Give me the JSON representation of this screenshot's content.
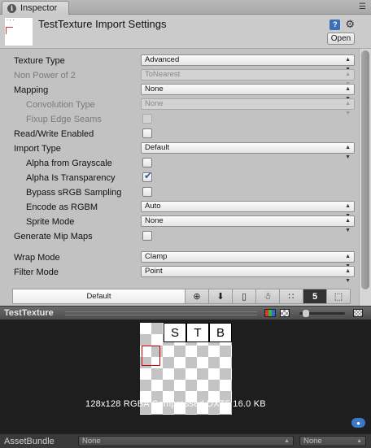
{
  "tab": {
    "label": "Inspector"
  },
  "header": {
    "title": "TestTexture Import Settings",
    "open_label": "Open",
    "thumb_dots": "˙˙˙"
  },
  "settings": {
    "texture_type": {
      "label": "Texture Type",
      "value": "Advanced"
    },
    "non_power_of_2": {
      "label": "Non Power of 2",
      "value": "ToNearest"
    },
    "mapping": {
      "label": "Mapping",
      "value": "None"
    },
    "convolution_type": {
      "label": "Convolution Type",
      "value": "None"
    },
    "fixup_edge_seams": {
      "label": "Fixup Edge Seams",
      "checked": false
    },
    "read_write_enabled": {
      "label": "Read/Write Enabled",
      "checked": false
    },
    "import_type": {
      "label": "Import Type",
      "value": "Default"
    },
    "alpha_from_grayscale": {
      "label": "Alpha from Grayscale",
      "checked": false
    },
    "alpha_is_transparency": {
      "label": "Alpha Is Transparency",
      "checked": true
    },
    "bypass_srgb_sampling": {
      "label": "Bypass sRGB Sampling",
      "checked": false
    },
    "encode_as_rgbm": {
      "label": "Encode as RGBM",
      "value": "Auto"
    },
    "sprite_mode": {
      "label": "Sprite Mode",
      "value": "None"
    },
    "generate_mip_maps": {
      "label": "Generate Mip Maps",
      "checked": false
    },
    "wrap_mode": {
      "label": "Wrap Mode",
      "value": "Clamp"
    },
    "filter_mode": {
      "label": "Filter Mode",
      "value": "Point"
    }
  },
  "platforms": {
    "default_label": "Default",
    "icons": [
      "globe-icon",
      "download-icon",
      "phone-icon",
      "android-icon",
      "blackberry-icon",
      "html5-icon",
      "package-icon"
    ],
    "glyphs": [
      "⊕",
      "⬇",
      "▯",
      "☃",
      "∷",
      "5",
      "⬚"
    ]
  },
  "preview": {
    "title": "TestTexture",
    "letters": [
      "S",
      "T",
      "B"
    ],
    "info": "128x128  RGBA Compressed DXT5    16.0 KB",
    "tag_glyph": "●"
  },
  "asset_bundle": {
    "label": "AssetBundle",
    "name_value": "None",
    "variant_value": "None"
  },
  "colors": {
    "accent": "#3d6fb6",
    "checkmark": "#2d5a9d",
    "selection_border": "#c00000"
  }
}
